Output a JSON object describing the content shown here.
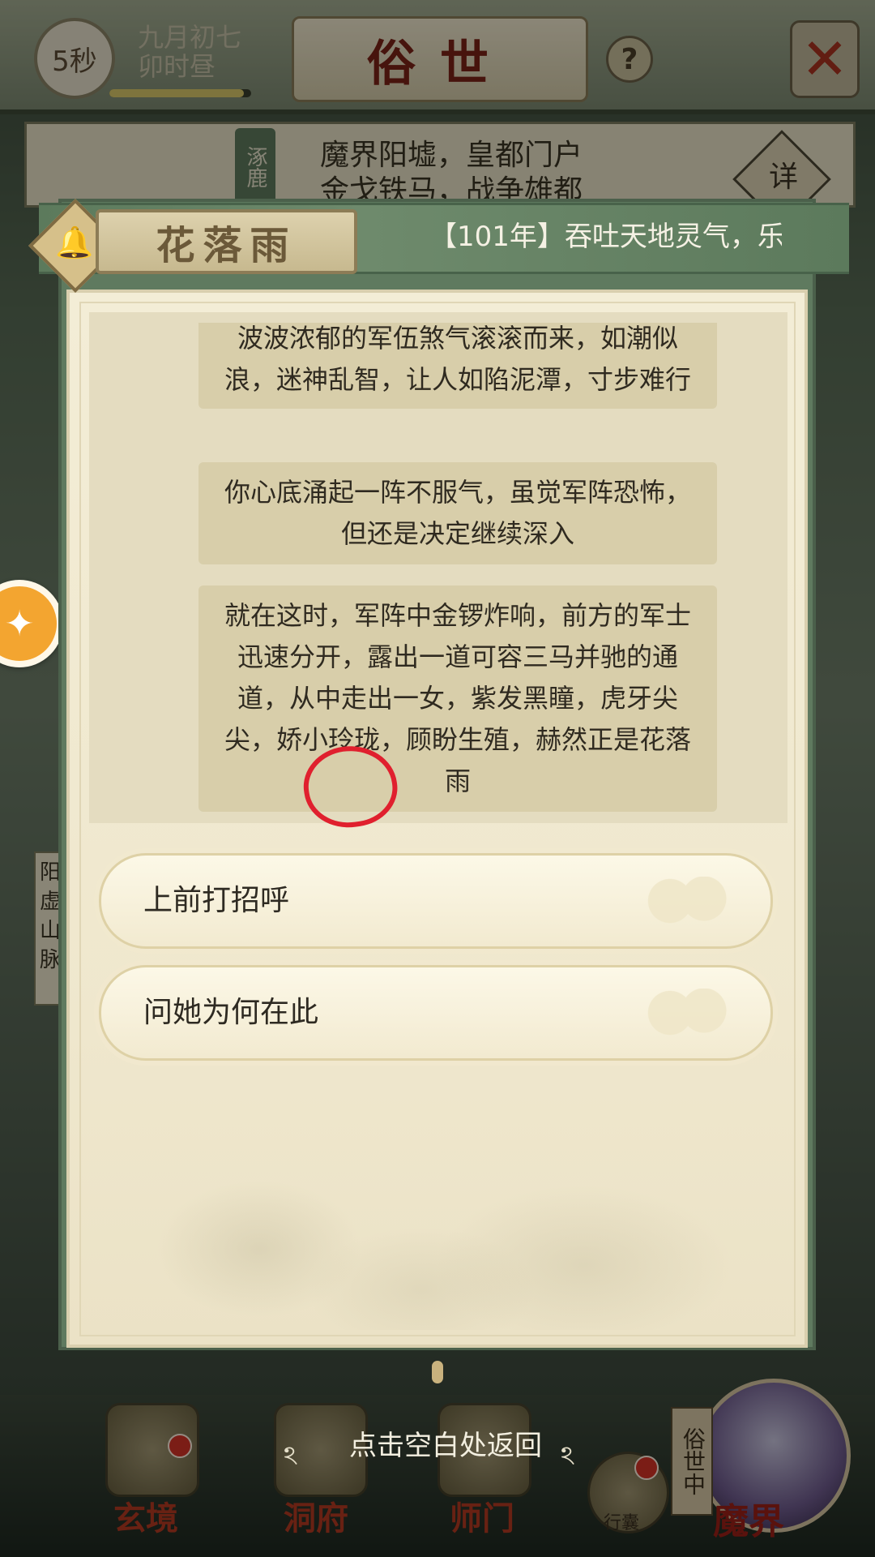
{
  "top_bar": {
    "timer": "5秒",
    "date_line1": "九月初七",
    "date_line2": "卯时昼",
    "date_progress": 0.95,
    "title": "俗世",
    "help": "?",
    "close": "✕"
  },
  "location": {
    "text_line1": "魔界阳墟，皇都门户",
    "text_line2": "金戈铁马，战争雄都",
    "tab_label": "涿鹿",
    "detail_label": "详"
  },
  "dialog": {
    "npc_name": "花落雨",
    "ticker": "【101年】吞吐天地灵气，乐",
    "paragraphs": [
      "波波浓郁的军伍煞气滚滚而来，如潮似浪，迷神乱智，让人如陷泥潭，寸步难行",
      "你心底涌起一阵不服气，虽觉军阵恐怖，但还是决定继续深入",
      "就在这时，军阵中金锣炸响，前方的军士迅速分开，露出一道可容三马并驰的通道，从中走出一女，紫发黑瞳，虎牙尖尖，娇小玲珑，顾盼生殖，赫然正是花落雨"
    ],
    "options": [
      "上前打招呼",
      "问她为何在此"
    ]
  },
  "hint": "点击空白处返回",
  "left_strip": "阳 虚 山 脉",
  "bottom_nav": {
    "items": [
      "玄境",
      "洞府",
      "师门",
      "行囊"
    ],
    "world_tag": "俗世中",
    "mojie": "魔界"
  },
  "colors": {
    "accent_red": "#e0202e",
    "dialog_green": "#5f7a5f",
    "paper": "#efe7cd"
  },
  "icons": {
    "bell": "bell-icon",
    "float": "gamepad-icon",
    "close": "close-icon"
  }
}
